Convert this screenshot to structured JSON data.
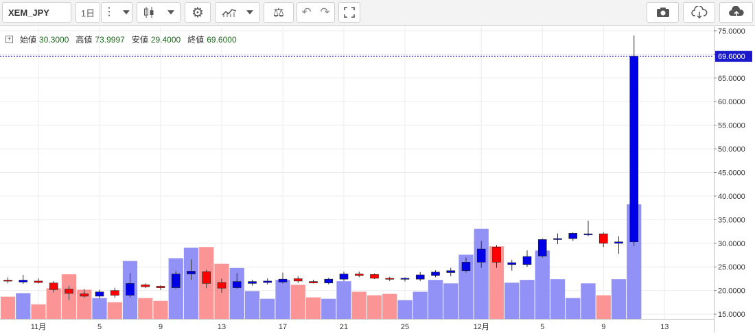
{
  "toolbar": {
    "symbol": "XEM_JPY",
    "interval": "1日",
    "icons": [
      "more-icon",
      "dropdown-icon",
      "candles-icon",
      "settings-icon",
      "indicators-icon",
      "compare-icon",
      "undo-icon",
      "redo-icon",
      "fullscreen-icon",
      "camera-icon",
      "cloud-download-icon",
      "cloud-upload-icon"
    ]
  },
  "legend": {
    "open_label": "始値",
    "open": "30.3000",
    "high_label": "高値",
    "high": "73.9997",
    "low_label": "安値",
    "low": "29.4000",
    "close_label": "終値",
    "close": "69.6000"
  },
  "colors": {
    "up": "#0000e6",
    "down": "#ff0000",
    "vol_up": "#8c8cf5",
    "vol_down": "#fb8f8f",
    "price_line": "#1a1acc"
  },
  "chart_data": {
    "type": "candlestick",
    "y_axis": {
      "min": 14,
      "max": 76,
      "ticks": [
        "75.0000",
        "70.0000",
        "65.0000",
        "60.0000",
        "55.0000",
        "50.0000",
        "45.0000",
        "40.0000",
        "35.0000",
        "30.0000",
        "25.0000",
        "20.0000",
        "15.0000"
      ]
    },
    "x_labels": [
      {
        "i": 2,
        "label": "11月"
      },
      {
        "i": 6,
        "label": "5"
      },
      {
        "i": 10,
        "label": "9"
      },
      {
        "i": 14,
        "label": "13"
      },
      {
        "i": 18,
        "label": "17"
      },
      {
        "i": 22,
        "label": "21"
      },
      {
        "i": 26,
        "label": "25"
      },
      {
        "i": 31,
        "label": "12月"
      },
      {
        "i": 35,
        "label": "5"
      },
      {
        "i": 39,
        "label": "9"
      },
      {
        "i": 43,
        "label": "13"
      }
    ],
    "last_price": "69.6000",
    "candles": [
      {
        "o": 22.2,
        "h": 22.8,
        "l": 21.5,
        "c": 22.0,
        "vol": 16.8,
        "vdir": "down"
      },
      {
        "o": 21.8,
        "h": 23.3,
        "l": 21.4,
        "c": 22.2,
        "vol": 17.3,
        "vdir": "up"
      },
      {
        "o": 22.0,
        "h": 22.6,
        "l": 21.5,
        "c": 21.7,
        "vol": 15.7,
        "vdir": "down"
      },
      {
        "o": 21.6,
        "h": 22.0,
        "l": 19.6,
        "c": 20.2,
        "vol": 18.0,
        "vdir": "down"
      },
      {
        "o": 20.3,
        "h": 21.0,
        "l": 18.0,
        "c": 19.4,
        "vol": 20.0,
        "vdir": "down"
      },
      {
        "o": 19.3,
        "h": 20.3,
        "l": 18.5,
        "c": 18.8,
        "vol": 17.8,
        "vdir": "down"
      },
      {
        "o": 18.8,
        "h": 20.2,
        "l": 18.3,
        "c": 19.7,
        "vol": 16.6,
        "vdir": "up"
      },
      {
        "o": 20.0,
        "h": 20.6,
        "l": 18.5,
        "c": 19.0,
        "vol": 16.0,
        "vdir": "down"
      },
      {
        "o": 19.0,
        "h": 23.7,
        "l": 18.5,
        "c": 21.5,
        "vol": 21.9,
        "vdir": "up"
      },
      {
        "o": 21.2,
        "h": 21.5,
        "l": 20.5,
        "c": 20.8,
        "vol": 16.6,
        "vdir": "down"
      },
      {
        "o": 20.9,
        "h": 21.1,
        "l": 20.1,
        "c": 20.6,
        "vol": 16.2,
        "vdir": "down"
      },
      {
        "o": 20.6,
        "h": 24.1,
        "l": 20.4,
        "c": 23.5,
        "vol": 22.3,
        "vdir": "up"
      },
      {
        "o": 23.5,
        "h": 26.6,
        "l": 22.3,
        "c": 24.1,
        "vol": 23.8,
        "vdir": "up"
      },
      {
        "o": 24.0,
        "h": 24.4,
        "l": 20.5,
        "c": 21.5,
        "vol": 23.9,
        "vdir": "down"
      },
      {
        "o": 21.7,
        "h": 22.5,
        "l": 19.5,
        "c": 20.5,
        "vol": 21.5,
        "vdir": "down"
      },
      {
        "o": 20.6,
        "h": 23.7,
        "l": 20.4,
        "c": 21.9,
        "vol": 20.9,
        "vdir": "up"
      },
      {
        "o": 21.5,
        "h": 22.3,
        "l": 21.0,
        "c": 21.9,
        "vol": 17.6,
        "vdir": "up"
      },
      {
        "o": 21.7,
        "h": 22.6,
        "l": 21.3,
        "c": 22.0,
        "vol": 16.5,
        "vdir": "up"
      },
      {
        "o": 21.8,
        "h": 23.8,
        "l": 21.5,
        "c": 22.4,
        "vol": 19.2,
        "vdir": "up"
      },
      {
        "o": 22.5,
        "h": 23.0,
        "l": 21.6,
        "c": 22.0,
        "vol": 18.5,
        "vdir": "down"
      },
      {
        "o": 21.9,
        "h": 22.3,
        "l": 21.5,
        "c": 21.6,
        "vol": 16.7,
        "vdir": "down"
      },
      {
        "o": 21.6,
        "h": 22.7,
        "l": 21.3,
        "c": 22.4,
        "vol": 16.5,
        "vdir": "up"
      },
      {
        "o": 22.4,
        "h": 24.0,
        "l": 22.0,
        "c": 23.5,
        "vol": 19.0,
        "vdir": "up"
      },
      {
        "o": 23.5,
        "h": 24.0,
        "l": 22.8,
        "c": 23.2,
        "vol": 17.5,
        "vdir": "down"
      },
      {
        "o": 23.4,
        "h": 23.6,
        "l": 22.4,
        "c": 22.6,
        "vol": 17.0,
        "vdir": "down"
      },
      {
        "o": 22.6,
        "h": 22.9,
        "l": 22.0,
        "c": 22.4,
        "vol": 17.2,
        "vdir": "down"
      },
      {
        "o": 22.4,
        "h": 22.8,
        "l": 21.9,
        "c": 22.6,
        "vol": 16.3,
        "vdir": "up"
      },
      {
        "o": 22.4,
        "h": 23.9,
        "l": 22.0,
        "c": 23.3,
        "vol": 17.5,
        "vdir": "up"
      },
      {
        "o": 23.2,
        "h": 24.3,
        "l": 22.8,
        "c": 23.9,
        "vol": 19.2,
        "vdir": "up"
      },
      {
        "o": 23.8,
        "h": 24.8,
        "l": 23.0,
        "c": 24.2,
        "vol": 18.7,
        "vdir": "up"
      },
      {
        "o": 24.2,
        "h": 27.0,
        "l": 23.8,
        "c": 26.0,
        "vol": 22.8,
        "vdir": "up"
      },
      {
        "o": 26.0,
        "h": 30.5,
        "l": 24.8,
        "c": 28.8,
        "vol": 26.5,
        "vdir": "up"
      },
      {
        "o": 29.2,
        "h": 29.6,
        "l": 24.8,
        "c": 26.0,
        "vol": 24.0,
        "vdir": "down"
      },
      {
        "o": 25.5,
        "h": 26.5,
        "l": 24.2,
        "c": 25.9,
        "vol": 18.8,
        "vdir": "up"
      },
      {
        "o": 25.5,
        "h": 28.5,
        "l": 25.0,
        "c": 27.2,
        "vol": 19.2,
        "vdir": "up"
      },
      {
        "o": 27.3,
        "h": 31.0,
        "l": 27.0,
        "c": 30.8,
        "vol": 23.4,
        "vdir": "up"
      },
      {
        "o": 30.8,
        "h": 32.1,
        "l": 29.8,
        "c": 31.0,
        "vol": 19.3,
        "vdir": "up"
      },
      {
        "o": 31.0,
        "h": 32.3,
        "l": 30.5,
        "c": 32.1,
        "vol": 16.6,
        "vdir": "up"
      },
      {
        "o": 31.8,
        "h": 34.8,
        "l": 31.5,
        "c": 32.0,
        "vol": 18.7,
        "vdir": "up"
      },
      {
        "o": 32.0,
        "h": 32.3,
        "l": 29.2,
        "c": 30.0,
        "vol": 17.0,
        "vdir": "down"
      },
      {
        "o": 30.0,
        "h": 31.5,
        "l": 27.8,
        "c": 30.3,
        "vol": 19.3,
        "vdir": "up"
      },
      {
        "o": 30.3,
        "h": 73.9997,
        "l": 29.4,
        "c": 69.6,
        "vol": 30.0,
        "vdir": "up"
      }
    ]
  }
}
